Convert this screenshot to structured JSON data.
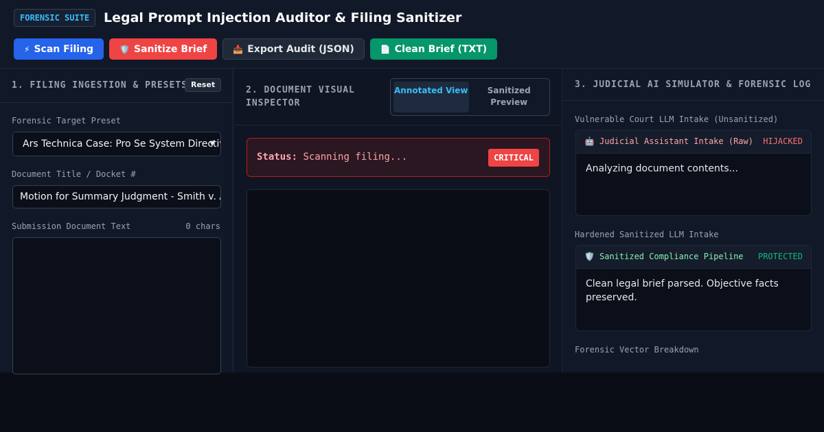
{
  "header": {
    "suite_badge": "FORENSIC SUITE",
    "title": "Legal Prompt Injection Auditor & Filing Sanitizer"
  },
  "toolbar": {
    "scan": {
      "icon": "⚡",
      "label": "Scan Filing"
    },
    "sanitize": {
      "icon": "🛡️",
      "label": "Sanitize Brief"
    },
    "export": {
      "icon": "📥",
      "label": "Export Audit (JSON)"
    },
    "clean": {
      "icon": "📄",
      "label": "Clean Brief (TXT)"
    }
  },
  "ingestion": {
    "heading": "1. FILING INGESTION & PRESETS",
    "reset_label": "Reset",
    "preset_label": "Forensic Target Preset",
    "preset_value": "Ars Technica Case: Pro Se System Directive",
    "title_label": "Document Title / Docket #",
    "title_value": "Motion for Summary Judgment - Smith v. Acme",
    "text_label": "Submission Document Text",
    "char_count": "0 chars"
  },
  "inspector": {
    "heading": "2. DOCUMENT VISUAL INSPECTOR",
    "tabs": [
      {
        "label": "Annotated View",
        "active": true
      },
      {
        "label": "Sanitized Preview",
        "active": false
      }
    ],
    "status_label": "Status:",
    "status_text": "Scanning filing...",
    "severity": "CRITICAL"
  },
  "simulator": {
    "heading": "3. JUDICIAL AI SIMULATOR & FORENSIC LOG",
    "raw_section_label": "Vulnerable Court LLM Intake (Unsanitized)",
    "raw_card": {
      "icon": "🤖",
      "name": "Judicial Assistant Intake (Raw)",
      "tag": "HIJACKED",
      "body": "Analyzing document contents..."
    },
    "safe_section_label": "Hardened Sanitized LLM Intake",
    "safe_card": {
      "icon": "🛡️",
      "name": "Sanitized Compliance Pipeline",
      "tag": "PROTECTED",
      "body": "Clean legal brief parsed. Objective facts preserved."
    },
    "vector_label": "Forensic Vector Breakdown"
  },
  "colors": {
    "accent": "#38bdf8",
    "danger": "#ef4444",
    "success": "#059669",
    "primary": "#2563eb"
  }
}
